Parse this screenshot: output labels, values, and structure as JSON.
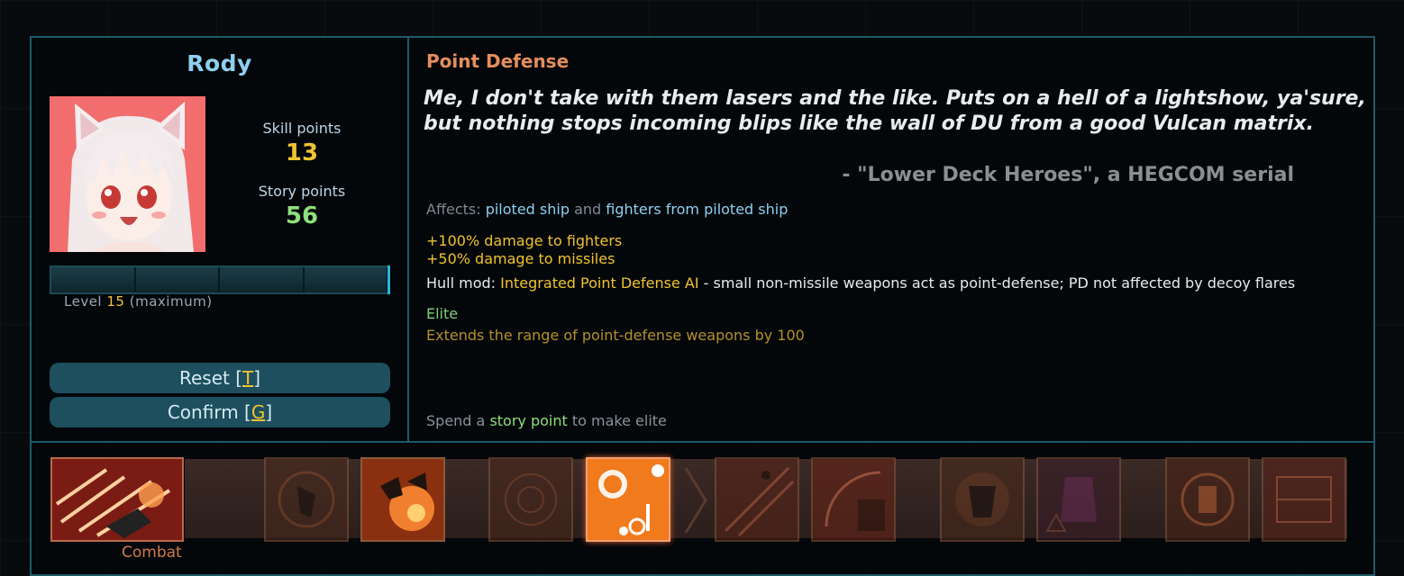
{
  "officer": {
    "name": "Rody",
    "skill_points_label": "Skill points",
    "skill_points": "13",
    "story_points_label": "Story points",
    "story_points": "56",
    "level_prefix": "Level",
    "level": "15",
    "level_suffix": "(maximum)",
    "level_progress": 1.0
  },
  "buttons": {
    "reset_label": "Reset [",
    "reset_key": "T",
    "confirm_label": "Confirm [",
    "confirm_key": "G",
    "close": "]"
  },
  "skill": {
    "title": "Point Defense",
    "quote": "Me, I don't take with them lasers and the like. Puts on a hell of a lightshow, ya'sure, but nothing stops incoming blips like the wall of DU from a good Vulcan matrix.",
    "quote_source": "- \"Lower Deck Heroes\", a HEGCOM serial",
    "affects_label": "Affects:",
    "affects_target_1": "piloted ship",
    "affects_and": "and",
    "affects_target_2": "fighters from piloted ship",
    "bonus_1": "+100% damage to fighters",
    "bonus_2": "+50% damage to missiles",
    "hullmod_label": "Hull mod:",
    "hullmod_name": "Integrated Point Defense AI",
    "hullmod_desc": "- small non-missile weapons act as point-defense; PD not affected by decoy flares",
    "elite_label": "Elite",
    "elite_desc": "Extends the range of point-defense weapons by 100",
    "spend_prefix": "Spend a",
    "spend_story": "story point",
    "spend_suffix": "to make elite"
  },
  "aptitude": {
    "label": "Combat"
  },
  "colors": {
    "accent_blue": "#8fd0f0",
    "skill_title": "#e58e5c",
    "gold": "#f0c330",
    "green": "#7fd07a",
    "border": "#1f5a6a"
  }
}
